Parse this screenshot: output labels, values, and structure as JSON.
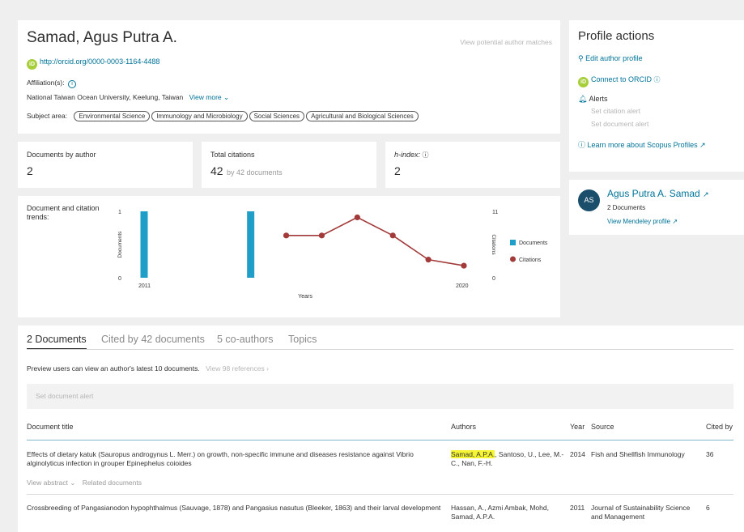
{
  "author": {
    "name": "Samad, Agus Putra A.",
    "orcid_url": "http://orcid.org/0000-0003-1164-4488",
    "potential_matches": "View potential author matches",
    "affiliation_label": "Affiliation(s):",
    "affiliation": "National Taiwan Ocean University, Keelung, Taiwan",
    "view_more": "View more",
    "subject_label": "Subject area:",
    "subjects": [
      "Environmental Science",
      "Immunology and Microbiology",
      "Social Sciences",
      "Agricultural and Biological Sciences"
    ]
  },
  "profile_actions": {
    "title": "Profile actions",
    "edit": "Edit author profile",
    "connect": "Connect to ORCID",
    "alerts": "Alerts",
    "citation_alert": "Set citation alert",
    "document_alert": "Set document alert",
    "learn_more": "Learn more about Scopus Profiles"
  },
  "mendeley": {
    "initials": "AS",
    "name": "Agus Putra A. Samad",
    "documents": "2 Documents",
    "profile_link": "View Mendeley profile"
  },
  "metrics": {
    "documents_label": "Documents by author",
    "documents_value": "2",
    "citations_label": "Total citations",
    "citations_value": "42",
    "citations_suffix": "by 42 documents",
    "hindex_label": "h-index:",
    "hindex_value": "2"
  },
  "chart_data": {
    "type": "bar+line",
    "title": "Document and citation trends:",
    "xlabel": "Years",
    "ylabel_left": "Documents",
    "ylabel_right": "Citations",
    "x_tick_labels": [
      "2011",
      "2020"
    ],
    "xlim": [
      2011,
      2020
    ],
    "left_ylim": [
      0,
      1
    ],
    "right_ylim": [
      0,
      11
    ],
    "series": [
      {
        "name": "Documents",
        "type": "bar",
        "color": "#1f9fc7",
        "x": [
          2011,
          2014
        ],
        "values": [
          1,
          1
        ]
      },
      {
        "name": "Citations",
        "type": "line",
        "color": "#a23a3a",
        "x": [
          2015,
          2016,
          2017,
          2018,
          2019,
          2020
        ],
        "values": [
          7,
          7,
          10,
          7,
          3,
          2
        ]
      }
    ],
    "legend": "right"
  },
  "tabs": [
    {
      "label": "2 Documents"
    },
    {
      "label": "Cited by 42 documents"
    },
    {
      "label": "5 co-authors"
    },
    {
      "label": "Topics"
    }
  ],
  "preview_note": "Preview users can view an author's latest 10 documents.",
  "view_refs": "View 98 references",
  "set_doc_alert": "Set document alert",
  "table": {
    "headers": {
      "title": "Document title",
      "authors": "Authors",
      "year": "Year",
      "source": "Source",
      "cited": "Cited by"
    },
    "rows": [
      {
        "title": "Effects of dietary katuk (Sauropus androgynus L. Merr.) on growth, non-specific immune and diseases resistance against Vibrio alginolyticus infection in grouper Epinephelus coioides",
        "authors_highlight": "Samad, A.P.A.",
        "authors_rest": ", Santoso, U., Lee, M.-C., Nan, F.-H.",
        "year": "2014",
        "source": "Fish and Shellfish Immunology",
        "cited": "36",
        "view_abstract": "View abstract",
        "related": "Related documents"
      },
      {
        "title": "Crossbreeding of Pangasianodon hypophthalmus (Sauvage, 1878) and Pangasius nasutus (Bleeker, 1863) and their larval development",
        "authors": "Hassan, A., Azmi Ambak, Mohd, Samad, A.P.A.",
        "year": "2011",
        "source": "Journal of Sustainability Science and Management",
        "cited": "6"
      }
    ]
  }
}
